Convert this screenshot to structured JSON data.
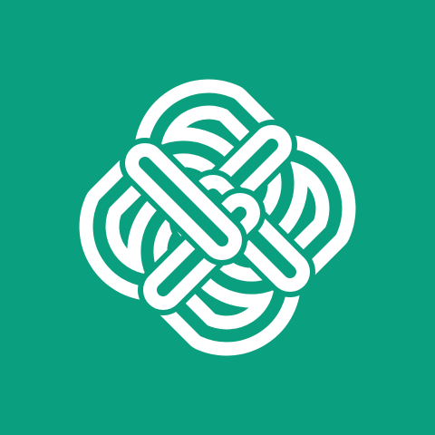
{
  "logo": {
    "icon": "interlaced-knot-logo-icon",
    "background_color": "#0a9f7e",
    "foreground_color": "#ffffff"
  }
}
